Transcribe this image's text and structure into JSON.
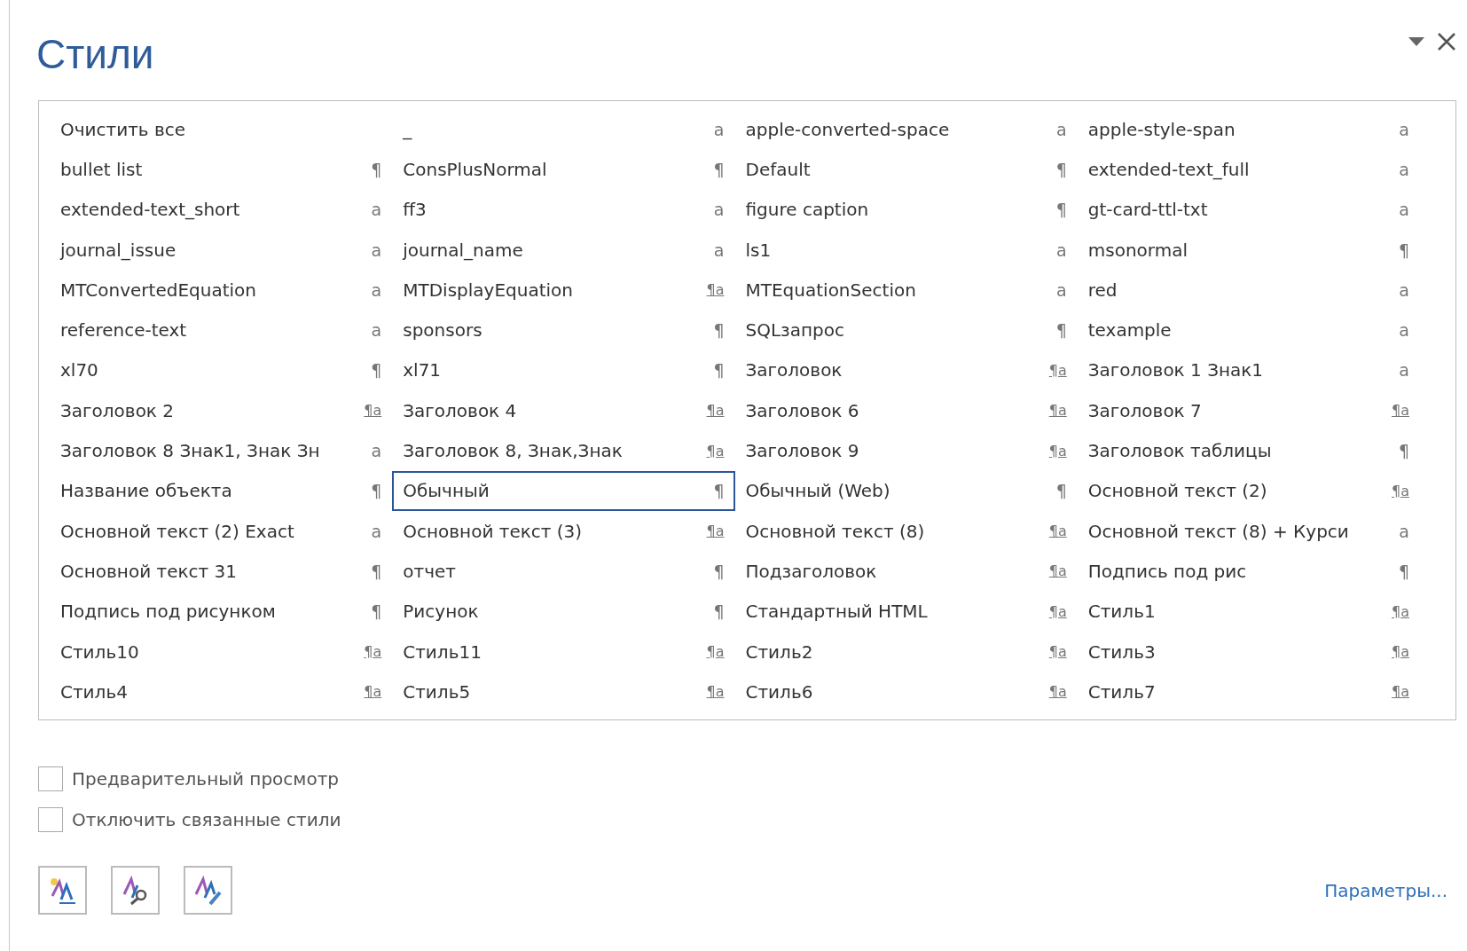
{
  "pane": {
    "title": "Стили"
  },
  "styles": [
    {
      "name": "Очистить все",
      "kind": "clear",
      "selected": false
    },
    {
      "name": "_",
      "kind": "char",
      "mark": "a",
      "selected": false
    },
    {
      "name": "apple-converted-space",
      "kind": "char",
      "mark": "a",
      "selected": false
    },
    {
      "name": "apple-style-span",
      "kind": "char",
      "mark": "a",
      "selected": false
    },
    {
      "name": "bullet list",
      "kind": "para",
      "mark": "¶",
      "selected": false
    },
    {
      "name": "ConsPlusNormal",
      "kind": "para",
      "mark": "¶",
      "selected": false
    },
    {
      "name": "Default",
      "kind": "para",
      "mark": "¶",
      "selected": false
    },
    {
      "name": "extended-text_full",
      "kind": "char",
      "mark": "a",
      "selected": false
    },
    {
      "name": "extended-text_short",
      "kind": "char",
      "mark": "a",
      "selected": false
    },
    {
      "name": "ff3",
      "kind": "char",
      "mark": "a",
      "selected": false
    },
    {
      "name": "figure caption",
      "kind": "para",
      "mark": "¶",
      "selected": false
    },
    {
      "name": "gt-card-ttl-txt",
      "kind": "char",
      "mark": "a",
      "selected": false
    },
    {
      "name": "journal_issue",
      "kind": "char",
      "mark": "a",
      "selected": false
    },
    {
      "name": "journal_name",
      "kind": "char",
      "mark": "a",
      "selected": false
    },
    {
      "name": "ls1",
      "kind": "char",
      "mark": "a",
      "selected": false
    },
    {
      "name": "msonormal",
      "kind": "para",
      "mark": "¶",
      "selected": false
    },
    {
      "name": "MTConvertedEquation",
      "kind": "char",
      "mark": "a",
      "selected": false
    },
    {
      "name": "MTDisplayEquation",
      "kind": "linked",
      "mark": "¶a",
      "selected": false
    },
    {
      "name": "MTEquationSection",
      "kind": "char",
      "mark": "a",
      "selected": false
    },
    {
      "name": "red",
      "kind": "char",
      "mark": "a",
      "selected": false
    },
    {
      "name": "reference-text",
      "kind": "char",
      "mark": "a",
      "selected": false
    },
    {
      "name": "sponsors",
      "kind": "para",
      "mark": "¶",
      "selected": false
    },
    {
      "name": "SQLзапрос",
      "kind": "para",
      "mark": "¶",
      "selected": false
    },
    {
      "name": "texample",
      "kind": "char",
      "mark": "a",
      "selected": false
    },
    {
      "name": "xl70",
      "kind": "para",
      "mark": "¶",
      "selected": false
    },
    {
      "name": "xl71",
      "kind": "para",
      "mark": "¶",
      "selected": false
    },
    {
      "name": "Заголовок",
      "kind": "linked",
      "mark": "¶a",
      "selected": false
    },
    {
      "name": "Заголовок 1 Знак1",
      "kind": "char",
      "mark": "a",
      "selected": false
    },
    {
      "name": "Заголовок 2",
      "kind": "linked",
      "mark": "¶a",
      "selected": false
    },
    {
      "name": "Заголовок 4",
      "kind": "linked",
      "mark": "¶a",
      "selected": false
    },
    {
      "name": "Заголовок 6",
      "kind": "linked",
      "mark": "¶a",
      "selected": false
    },
    {
      "name": "Заголовок 7",
      "kind": "linked",
      "mark": "¶a",
      "selected": false
    },
    {
      "name": "Заголовок 8 Знак1, Знак Зн",
      "kind": "char",
      "mark": "a",
      "selected": false
    },
    {
      "name": "Заголовок 8, Знак,Знак",
      "kind": "linked",
      "mark": "¶a",
      "selected": false
    },
    {
      "name": "Заголовок 9",
      "kind": "linked",
      "mark": "¶a",
      "selected": false
    },
    {
      "name": "Заголовок таблицы",
      "kind": "para",
      "mark": "¶",
      "selected": false
    },
    {
      "name": "Название объекта",
      "kind": "para",
      "mark": "¶",
      "selected": false
    },
    {
      "name": "Обычный",
      "kind": "para",
      "mark": "¶",
      "selected": true
    },
    {
      "name": "Обычный (Web)",
      "kind": "para",
      "mark": "¶",
      "selected": false
    },
    {
      "name": "Основной текст (2)",
      "kind": "linked",
      "mark": "¶a",
      "selected": false
    },
    {
      "name": "Основной текст (2) Exact",
      "kind": "char",
      "mark": "a",
      "selected": false
    },
    {
      "name": "Основной текст (3)",
      "kind": "linked",
      "mark": "¶a",
      "selected": false
    },
    {
      "name": "Основной текст (8)",
      "kind": "linked",
      "mark": "¶a",
      "selected": false
    },
    {
      "name": "Основной текст (8) + Курси",
      "kind": "char",
      "mark": "a",
      "selected": false
    },
    {
      "name": "Основной текст 31",
      "kind": "para",
      "mark": "¶",
      "selected": false
    },
    {
      "name": "отчет",
      "kind": "para",
      "mark": "¶",
      "selected": false
    },
    {
      "name": "Подзаголовок",
      "kind": "linked",
      "mark": "¶a",
      "selected": false
    },
    {
      "name": "Подпись под рис",
      "kind": "para",
      "mark": "¶",
      "selected": false
    },
    {
      "name": "Подпись под рисунком",
      "kind": "para",
      "mark": "¶",
      "selected": false
    },
    {
      "name": "Рисунок",
      "kind": "para",
      "mark": "¶",
      "selected": false
    },
    {
      "name": "Стандартный HTML",
      "kind": "linked",
      "mark": "¶a",
      "selected": false
    },
    {
      "name": "Стиль1",
      "kind": "linked",
      "mark": "¶a",
      "selected": false
    },
    {
      "name": "Стиль10",
      "kind": "linked",
      "mark": "¶a",
      "selected": false
    },
    {
      "name": "Стиль11",
      "kind": "linked",
      "mark": "¶a",
      "selected": false
    },
    {
      "name": "Стиль2",
      "kind": "linked",
      "mark": "¶a",
      "selected": false
    },
    {
      "name": "Стиль3",
      "kind": "linked",
      "mark": "¶a",
      "selected": false
    },
    {
      "name": "Стиль4",
      "kind": "linked",
      "mark": "¶a",
      "selected": false
    },
    {
      "name": "Стиль5",
      "kind": "linked",
      "mark": "¶a",
      "selected": false
    },
    {
      "name": "Стиль6",
      "kind": "linked",
      "mark": "¶a",
      "selected": false
    },
    {
      "name": "Стиль7",
      "kind": "linked",
      "mark": "¶a",
      "selected": false
    }
  ],
  "options": [
    {
      "label": "Предварительный просмотр",
      "checked": false
    },
    {
      "label": "Отключить связанные стили",
      "checked": false
    }
  ],
  "tools": [
    {
      "kind": "new-style"
    },
    {
      "kind": "inspector"
    },
    {
      "kind": "manage"
    }
  ],
  "link": "Параметры..."
}
